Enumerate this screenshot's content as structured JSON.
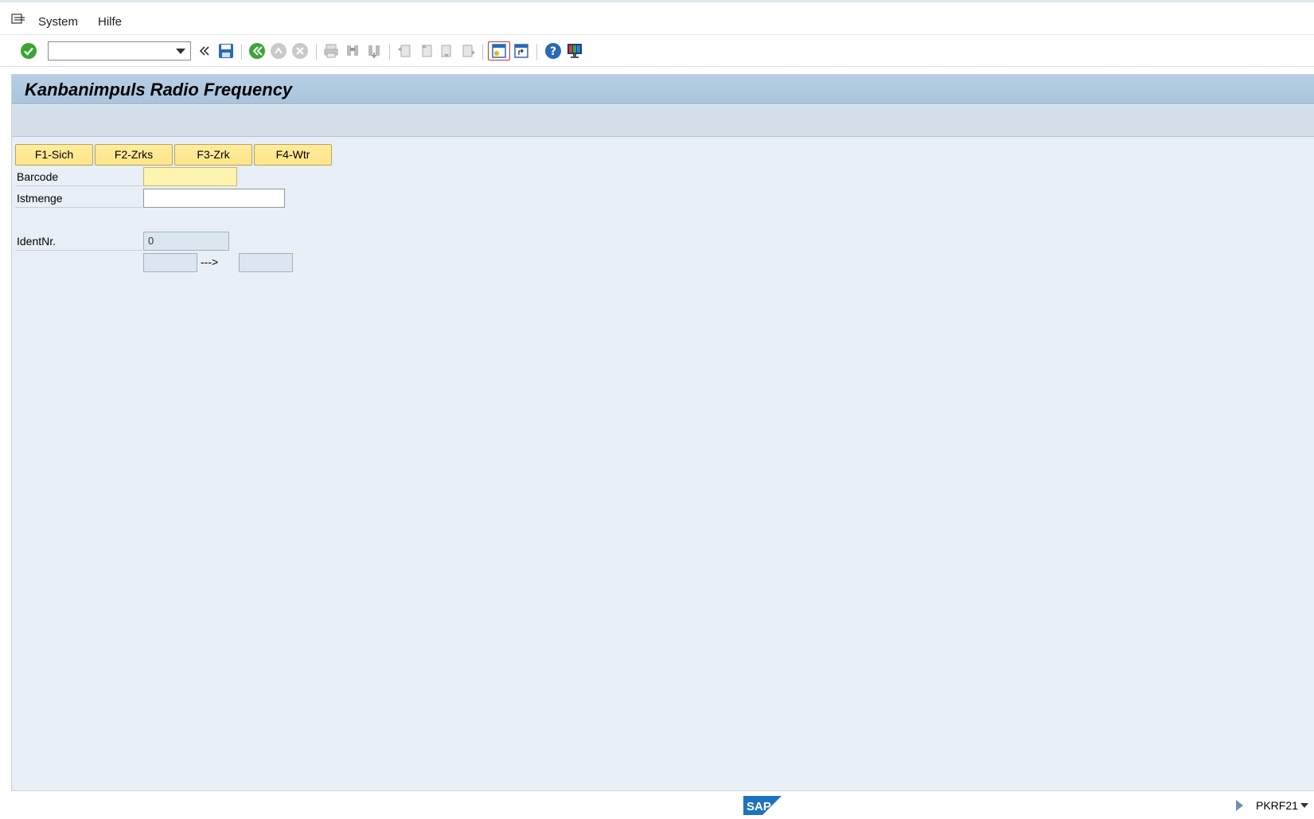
{
  "menu": {
    "items": [
      {
        "label": "System"
      },
      {
        "label": "Hilfe"
      }
    ]
  },
  "toolbar": {
    "command_field_value": "",
    "icons": [
      "enter-icon",
      "command-dropdown-icon",
      "collapse-icon",
      "save-icon",
      "back-icon",
      "exit-icon",
      "cancel-icon",
      "print-icon",
      "find-icon",
      "find-next-icon",
      "first-page-icon",
      "previous-page-icon",
      "next-page-icon",
      "last-page-icon",
      "new-session-icon",
      "create-shortcut-icon",
      "help-icon",
      "customize-layout-icon"
    ]
  },
  "screen": {
    "title": "Kanbanimpuls Radio Frequency",
    "function_buttons": [
      {
        "label": "F1-Sich"
      },
      {
        "label": "F2-Zrks"
      },
      {
        "label": "F3-Zrk"
      },
      {
        "label": "F4-Wtr"
      }
    ],
    "fields": {
      "barcode": {
        "label": "Barcode",
        "value": ""
      },
      "istmenge": {
        "label": "Istmenge",
        "value": ""
      },
      "identnr": {
        "label": "IdentNr.",
        "value": "0"
      },
      "range_from": {
        "value": ""
      },
      "range_arrow": "--->",
      "range_to": {
        "value": ""
      }
    }
  },
  "statusbar": {
    "logo_text": "SAP",
    "transaction_code": "PKRF21"
  },
  "colors": {
    "title_bar": "#b9d0e4",
    "work_area": "#e8eff6",
    "function_button": "#fde58a",
    "required_field": "#fff3b0",
    "enter_icon": "#3aa535",
    "sap_blue": "#1e73be"
  }
}
